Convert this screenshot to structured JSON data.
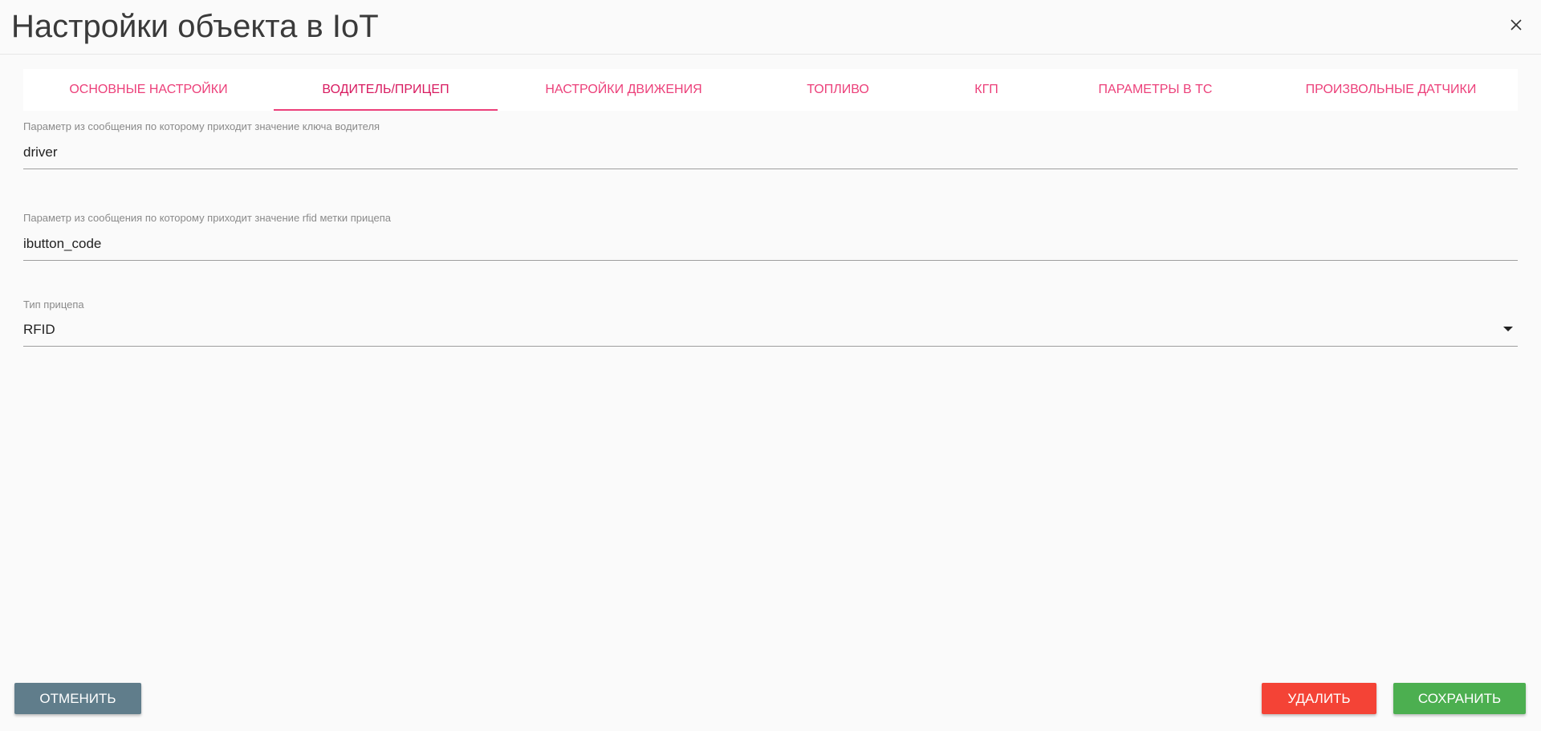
{
  "header": {
    "title": "Настройки объекта в IoT"
  },
  "tabs": [
    {
      "label": "Основные настройки",
      "active": false
    },
    {
      "label": "Водитель/Прицеп",
      "active": true
    },
    {
      "label": "Настройки движения",
      "active": false
    },
    {
      "label": "Топливо",
      "active": false
    },
    {
      "label": "КГП",
      "active": false
    },
    {
      "label": "Параметры в ТС",
      "active": false
    },
    {
      "label": "Произвольные датчики",
      "active": false
    }
  ],
  "fields": {
    "driver_key": {
      "label": "Параметр из сообщения по которому приходит значение ключа водителя",
      "value": "driver"
    },
    "trailer_rfid": {
      "label": "Параметр из сообщения по которому приходит значение rfid метки прицепа",
      "value": "ibutton_code"
    },
    "trailer_type": {
      "label": "Тип прицепа",
      "value": "RFID"
    }
  },
  "buttons": {
    "cancel": "Отменить",
    "delete": "Удалить",
    "save": "Сохранить"
  },
  "colors": {
    "accent": "#ec407a",
    "cancel": "#607d8b",
    "delete": "#f44336",
    "save": "#4caf50"
  },
  "icons": {
    "close": "close-icon",
    "dropdown": "chevron-down-icon"
  }
}
